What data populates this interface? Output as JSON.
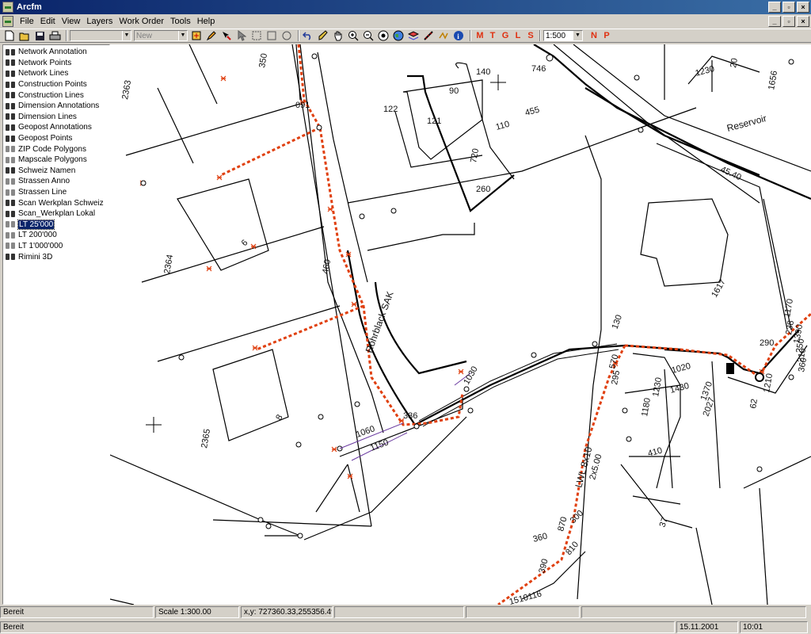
{
  "window": {
    "title": "Arcfm"
  },
  "menu": [
    "File",
    "Edit",
    "View",
    "Layers",
    "Work Order",
    "Tools",
    "Help"
  ],
  "toolbar": {
    "combo1": "",
    "combo2": "New",
    "scale": "1:500",
    "letters": [
      "M",
      "T",
      "G",
      "L",
      "S"
    ],
    "letters2": [
      "N",
      "P"
    ]
  },
  "layers": [
    {
      "label": "Network Annotation",
      "dim": false
    },
    {
      "label": "Network Points",
      "dim": false
    },
    {
      "label": "Network Lines",
      "dim": false
    },
    {
      "label": "Construction Points",
      "dim": false
    },
    {
      "label": "Construction Lines",
      "dim": false
    },
    {
      "label": "Dimension Annotations",
      "dim": false
    },
    {
      "label": "Dimension Lines",
      "dim": false
    },
    {
      "label": "Geopost Annotations",
      "dim": false
    },
    {
      "label": "Geopost Points",
      "dim": false
    },
    {
      "label": "ZIP Code Polygons",
      "dim": true
    },
    {
      "label": "Mapscale Polygons",
      "dim": true
    },
    {
      "label": "Schweiz Namen",
      "dim": false
    },
    {
      "label": "Strassen Anno",
      "dim": true
    },
    {
      "label": "Strassen Line",
      "dim": true
    },
    {
      "label": "Scan Werkplan Schweiz",
      "dim": false
    },
    {
      "label": "Scan_Werkplan Lokal",
      "dim": false
    },
    {
      "label": "LT 25'000",
      "dim": true,
      "selected": true
    },
    {
      "label": "LT 200'000",
      "dim": true
    },
    {
      "label": "LT 1'000'000",
      "dim": true
    },
    {
      "label": "Rimini 3D",
      "dim": false
    }
  ],
  "map": {
    "labels": [
      "2363",
      "350",
      "091",
      "122",
      "90",
      "140",
      "746",
      "121",
      "110",
      "455",
      "1230",
      "20",
      "Reservoir",
      "1656",
      "2364",
      "720",
      "260",
      "45.40",
      "1617",
      "6",
      "460",
      "Rohrblack SAK",
      "2365",
      "8",
      "1060",
      "1150",
      "336",
      "1030",
      "130",
      "290",
      "1170",
      "1020",
      "570",
      "1430",
      "2027",
      "1180",
      "1230",
      "1370",
      "295",
      "410",
      "LWL 8x10",
      "2x5.00",
      "37",
      "360",
      "870",
      "300",
      "810",
      "390",
      "1510116",
      "62",
      "1210",
      "238",
      "1390",
      "250",
      "210",
      "360"
    ]
  },
  "status": {
    "bar1": {
      "ready": "Bereit",
      "scale": "Scale 1:300.00",
      "coords": "x,y: 727360.33,255356.49"
    },
    "bar2": {
      "ready": "Bereit",
      "date": "15.11.2001",
      "time": "10:01"
    }
  }
}
